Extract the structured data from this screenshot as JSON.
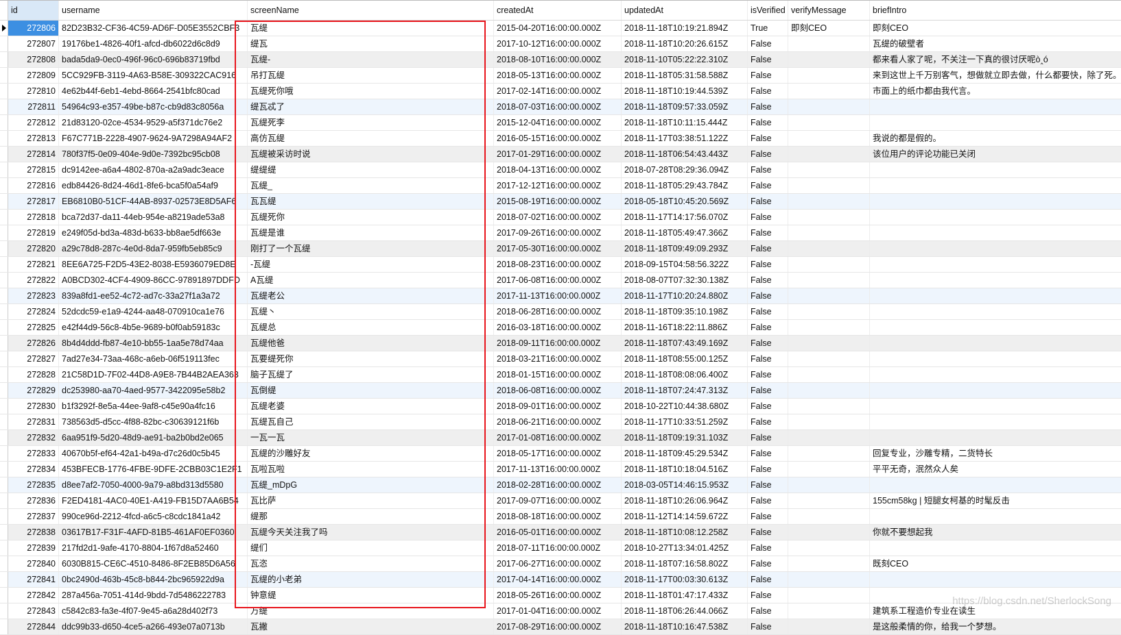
{
  "columns": [
    "id",
    "username",
    "screenName",
    "createdAt",
    "updatedAt",
    "isVerified",
    "verifyMessage",
    "briefIntro"
  ],
  "selected_row_id": "272806",
  "highlight_color": "#e8141b",
  "watermark": "https://blog.csdn.net/SherlockSong",
  "rows": [
    [
      "272806",
      "82D23B32-CF36-4C59-AD6F-D05E3552CBF3",
      "瓦缇",
      "2015-04-20T16:00:00.000Z",
      "2018-11-18T10:19:21.894Z",
      "True",
      "即刻CEO",
      "即刻CEO"
    ],
    [
      "272807",
      "19176be1-4826-40f1-afcd-db6022d6c8d9",
      "缇瓦",
      "2017-10-12T16:00:00.000Z",
      "2018-11-18T10:20:26.615Z",
      "False",
      "",
      "瓦缇的破壁者"
    ],
    [
      "272808",
      "bada5da9-0ec0-496f-96c0-696b83719fbd",
      "瓦缇-",
      "2018-08-10T16:00:00.000Z",
      "2018-11-10T05:22:22.310Z",
      "False",
      "",
      "都来看人家了呢，不关注一下真的很讨厌呢ò‸ó"
    ],
    [
      "272809",
      "5CC929FB-3119-4A63-B58E-309322CAC916",
      "吊打瓦缇",
      "2018-05-13T16:00:00.000Z",
      "2018-11-18T05:31:58.588Z",
      "False",
      "",
      "来到这世上千万别客气，想做就立即去做，什么都要快，除了死。"
    ],
    [
      "272810",
      "4e62b44f-6eb1-4ebd-8664-2541bfc80cad",
      "瓦缇死你哦",
      "2017-02-14T16:00:00.000Z",
      "2018-11-18T10:19:44.539Z",
      "False",
      "",
      "市面上的纸巾都由我代言。"
    ],
    [
      "272811",
      "54964c93-e357-49be-b87c-cb9d83c8056a",
      "缇瓦忒了",
      "2018-07-03T16:00:00.000Z",
      "2018-11-18T09:57:33.059Z",
      "False",
      "",
      ""
    ],
    [
      "272812",
      "21d83120-02ce-4534-9529-a5f371dc76e2",
      "瓦缇死李",
      "2015-12-04T16:00:00.000Z",
      "2018-11-18T10:11:15.444Z",
      "False",
      "",
      ""
    ],
    [
      "272813",
      "F67C771B-2228-4907-9624-9A7298A94AF2",
      "高仿瓦缇",
      "2016-05-15T16:00:00.000Z",
      "2018-11-17T03:38:51.122Z",
      "False",
      "",
      "我说的都是假的。"
    ],
    [
      "272814",
      "780f37f5-0e09-404e-9d0e-7392bc95cb08",
      "瓦缇被采访时说",
      "2017-01-29T16:00:00.000Z",
      "2018-11-18T06:54:43.443Z",
      "False",
      "",
      "该位用户的评论功能已关闭"
    ],
    [
      "272815",
      "dc9142ee-a6a4-4802-870a-a2a9adc3eace",
      "缇缇缇",
      "2018-04-13T16:00:00.000Z",
      "2018-07-28T08:29:36.094Z",
      "False",
      "",
      ""
    ],
    [
      "272816",
      "edb84426-8d24-46d1-8fe6-bca5f0a54af9",
      "瓦缇_",
      "2017-12-12T16:00:00.000Z",
      "2018-11-18T05:29:43.784Z",
      "False",
      "",
      ""
    ],
    [
      "272817",
      "EB6810B0-51CF-44AB-8937-02573E8D5AF6",
      "瓦瓦缇",
      "2015-08-19T16:00:00.000Z",
      "2018-05-18T10:45:20.569Z",
      "False",
      "",
      ""
    ],
    [
      "272818",
      "bca72d37-da11-44eb-954e-a8219ade53a8",
      "瓦缇死你",
      "2018-07-02T16:00:00.000Z",
      "2018-11-17T14:17:56.070Z",
      "False",
      "",
      ""
    ],
    [
      "272819",
      "e249f05d-bd3a-483d-b633-bb8ae5df663e",
      "瓦缇是谁",
      "2017-09-26T16:00:00.000Z",
      "2018-11-18T05:49:47.366Z",
      "False",
      "",
      ""
    ],
    [
      "272820",
      "a29c78d8-287c-4e0d-8da7-959fb5eb85c9",
      "刚打了一个瓦缇",
      "2017-05-30T16:00:00.000Z",
      "2018-11-18T09:49:09.293Z",
      "False",
      "",
      ""
    ],
    [
      "272821",
      "8EE6A725-F2D5-43E2-8038-E5936079ED8E",
      "-瓦缇",
      "2018-08-23T16:00:00.000Z",
      "2018-09-15T04:58:56.322Z",
      "False",
      "",
      ""
    ],
    [
      "272822",
      "A0BCD302-4CF4-4909-86CC-97891897DDFD",
      "A瓦缇",
      "2017-06-08T16:00:00.000Z",
      "2018-08-07T07:32:30.138Z",
      "False",
      "",
      ""
    ],
    [
      "272823",
      "839a8fd1-ee52-4c72-ad7c-33a27f1a3a72",
      "瓦缇老公",
      "2017-11-13T16:00:00.000Z",
      "2018-11-17T10:20:24.880Z",
      "False",
      "",
      ""
    ],
    [
      "272824",
      "52dcdc59-e1a9-4244-aa48-070910ca1e76",
      "瓦缇丶",
      "2018-06-28T16:00:00.000Z",
      "2018-11-18T09:35:10.198Z",
      "False",
      "",
      ""
    ],
    [
      "272825",
      "e42f44d9-56c8-4b5e-9689-b0f0ab59183c",
      "瓦缇总",
      "2016-03-18T16:00:00.000Z",
      "2018-11-16T18:22:11.886Z",
      "False",
      "",
      ""
    ],
    [
      "272826",
      "8b4d4ddd-fb87-4e10-bb55-1aa5e78d74aa",
      "瓦缇他爸",
      "2018-09-11T16:00:00.000Z",
      "2018-11-18T07:43:49.169Z",
      "False",
      "",
      ""
    ],
    [
      "272827",
      "7ad27e34-73aa-468c-a6eb-06f519113fec",
      "瓦要缇死你",
      "2018-03-21T16:00:00.000Z",
      "2018-11-18T08:55:00.125Z",
      "False",
      "",
      ""
    ],
    [
      "272828",
      "21C58D1D-7F02-44D8-A9E8-7B44B2AEA363",
      "脑子瓦缇了",
      "2018-01-15T16:00:00.000Z",
      "2018-11-18T08:08:06.400Z",
      "False",
      "",
      ""
    ],
    [
      "272829",
      "dc253980-aa70-4aed-9577-3422095e58b2",
      "瓦倒缇",
      "2018-06-08T16:00:00.000Z",
      "2018-11-18T07:24:47.313Z",
      "False",
      "",
      ""
    ],
    [
      "272830",
      "b1f3292f-8e5a-44ee-9af8-c45e90a4fc16",
      "瓦缇老婆",
      "2018-09-01T16:00:00.000Z",
      "2018-10-22T10:44:38.680Z",
      "False",
      "",
      ""
    ],
    [
      "272831",
      "738563d5-d5cc-4f88-82bc-c30639121f6b",
      "瓦缇瓦自己",
      "2018-06-21T16:00:00.000Z",
      "2018-11-17T10:33:51.259Z",
      "False",
      "",
      ""
    ],
    [
      "272832",
      "6aa951f9-5d20-48d9-ae91-ba2b0bd2e065",
      "一瓦一瓦",
      "2017-01-08T16:00:00.000Z",
      "2018-11-18T09:19:31.103Z",
      "False",
      "",
      ""
    ],
    [
      "272833",
      "40670b5f-ef64-42a1-b49a-d7c26d0c5b45",
      "瓦缇的沙雕好友",
      "2018-05-17T16:00:00.000Z",
      "2018-11-18T09:45:29.534Z",
      "False",
      "",
      "回复专业，沙雕专精，二货特长"
    ],
    [
      "272834",
      "453BFECB-1776-4FBE-9DFE-2CBB03C1E2F1",
      "瓦啦瓦啦",
      "2017-11-13T16:00:00.000Z",
      "2018-11-18T10:18:04.516Z",
      "False",
      "",
      "平平无奇，泯然众人矣"
    ],
    [
      "272835",
      "d8ee7af2-7050-4000-9a79-a8bd313d5580",
      "瓦缇_mDpG",
      "2018-02-28T16:00:00.000Z",
      "2018-03-05T14:46:15.953Z",
      "False",
      "",
      ""
    ],
    [
      "272836",
      "F2ED4181-4AC0-40E1-A419-FB15D7AA6B54",
      "瓦比萨",
      "2017-09-07T16:00:00.000Z",
      "2018-11-18T10:26:06.964Z",
      "False",
      "",
      "155cm58kg | 短腿女柯基的时髦反击"
    ],
    [
      "272837",
      "990ce96d-2212-4fcd-a6c5-c8cdc1841a42",
      "缇那",
      "2018-08-18T16:00:00.000Z",
      "2018-11-12T14:14:59.672Z",
      "False",
      "",
      ""
    ],
    [
      "272838",
      "03617B17-F31F-4AFD-81B5-461AF0EF0360",
      "瓦缇今天关注我了吗",
      "2016-05-01T16:00:00.000Z",
      "2018-11-18T10:08:12.258Z",
      "False",
      "",
      "你就不要想起我"
    ],
    [
      "272839",
      "217fd2d1-9afe-4170-8804-1f67d8a52460",
      "缇们",
      "2018-07-11T16:00:00.000Z",
      "2018-10-27T13:34:01.425Z",
      "False",
      "",
      ""
    ],
    [
      "272840",
      "6030B815-CE6C-4510-8486-8F2EB85D6A56",
      "瓦恣",
      "2017-06-27T16:00:00.000Z",
      "2018-11-18T07:16:58.802Z",
      "False",
      "",
      "既刻CEO"
    ],
    [
      "272841",
      "0bc2490d-463b-45c8-b844-2bc965922d9a",
      "瓦缇的小老弟",
      "2017-04-14T16:00:00.000Z",
      "2018-11-17T00:03:30.613Z",
      "False",
      "",
      ""
    ],
    [
      "272842",
      "287a456a-7051-414d-9bdd-7d5486222783",
      "钟意缇",
      "2018-05-26T16:00:00.000Z",
      "2018-11-18T01:47:17.433Z",
      "False",
      "",
      ""
    ],
    [
      "272843",
      "c5842c83-fa3e-4f07-9e45-a6a28d402f73",
      "万缇",
      "2017-01-04T16:00:00.000Z",
      "2018-11-18T06:26:44.066Z",
      "False",
      "",
      "建筑系工程造价专业在读生"
    ],
    [
      "272844",
      "ddc99b33-d650-4ce5-a266-493e07a0713b",
      "瓦撇",
      "2017-08-29T16:00:00.000Z",
      "2018-11-18T10:16:47.538Z",
      "False",
      "",
      "是这般柔情的你，给我一个梦想。"
    ]
  ]
}
